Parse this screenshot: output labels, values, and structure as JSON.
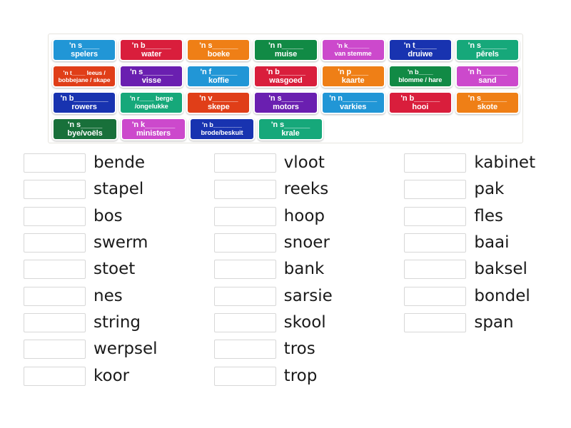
{
  "tile_bank": {
    "name": "word-tile-bank",
    "rows": [
      [
        {
          "line1": "'n s____",
          "line2": "spelers",
          "color": "#2196d6"
        },
        {
          "line1": "'n b______",
          "line2": "water",
          "color": "#d91e3c"
        },
        {
          "line1": "'n s______",
          "line2": "boeke",
          "color": "#ef7f16"
        },
        {
          "line1": "'n n_____",
          "line2": "muise",
          "color": "#118a45"
        },
        {
          "line1": "'n k______",
          "line2": "van stemme",
          "color": "#cc49cc",
          "size": "sm"
        },
        {
          "line1": "'n t_____",
          "line2": "druiwe",
          "color": "#1833b0"
        },
        {
          "line1": "'n s______",
          "line2": "pêrels",
          "color": "#16a87a"
        }
      ],
      [
        {
          "line1": "'n t____ leeus /",
          "line2": "bobbejane / skape",
          "color": "#e03e18",
          "size": "xs"
        },
        {
          "line1": "'n s_______",
          "line2": "visse",
          "color": "#6a1fb0"
        },
        {
          "line1": "'n f______",
          "line2": "koffie",
          "color": "#2196d6"
        },
        {
          "line1": "'n b______",
          "line2": "wasgoed",
          "color": "#d91e3c"
        },
        {
          "line1": "'n p____",
          "line2": "kaarte",
          "color": "#ef7f16"
        },
        {
          "line1": "'n b____",
          "line2": "blomme / hare",
          "color": "#118a45",
          "size": "sm"
        },
        {
          "line1": "'n h______",
          "line2": "sand",
          "color": "#cc49cc"
        }
      ],
      [
        {
          "line1": "'n b________",
          "line2": "rowers",
          "color": "#1833b0"
        },
        {
          "line1": "'n r____ berge",
          "line2": "/ongelukke",
          "color": "#16a87a",
          "size": "sm"
        },
        {
          "line1": "'n v______",
          "line2": "skepe",
          "color": "#e03e18"
        },
        {
          "line1": "'n s_____",
          "line2": "motors",
          "color": "#6a1fb0"
        },
        {
          "line1": "'n n________",
          "line2": "varkies",
          "color": "#2196d6"
        },
        {
          "line1": "'n b______",
          "line2": "hooi",
          "color": "#d91e3c"
        },
        {
          "line1": "'n s______",
          "line2": "skote",
          "color": "#ef7f16"
        }
      ],
      [
        {
          "line1": "'n s_____",
          "line2": "bye/voëls",
          "color": "#18703a"
        },
        {
          "line1": "'n k_______",
          "line2": "ministers",
          "color": "#cc49cc"
        },
        {
          "line1": "'n b________",
          "line2": "brode/beskuit",
          "color": "#1833b0",
          "size": "sm"
        },
        {
          "line1": "'n s______",
          "line2": "krale",
          "color": "#16a87a"
        }
      ]
    ]
  },
  "answers": {
    "columns": [
      {
        "name": "answer-column-1",
        "items": [
          "bende",
          "stapel",
          "bos",
          "swerm",
          "stoet",
          "nes",
          "string",
          "werpsel",
          "koor"
        ]
      },
      {
        "name": "answer-column-2",
        "items": [
          "vloot",
          "reeks",
          "hoop",
          "snoer",
          "bank",
          "sarsie",
          "skool",
          "tros",
          "trop"
        ]
      },
      {
        "name": "answer-column-3",
        "items": [
          "kabinet",
          "pak",
          "fles",
          "baai",
          "baksel",
          "bondel",
          "span"
        ]
      }
    ],
    "slot_placeholder": ""
  },
  "colors": {
    "tile_border": "#ffffff",
    "bank_border": "#e6e4de",
    "slot_border": "#d7d7d7",
    "text": "#1a1a1a",
    "tile_text": "#ffffff"
  }
}
